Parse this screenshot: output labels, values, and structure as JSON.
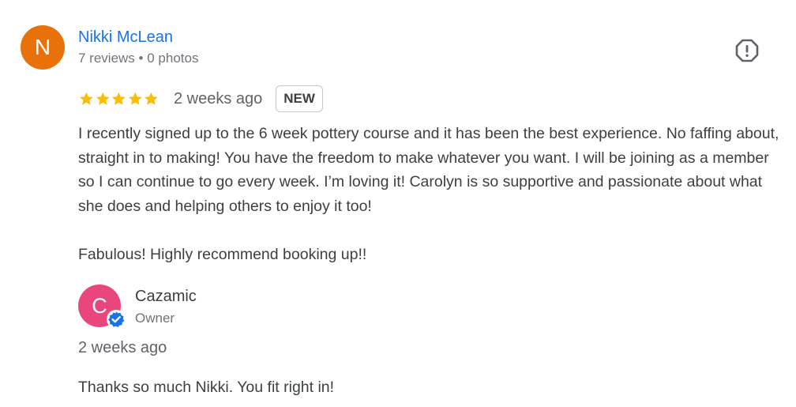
{
  "reviewer": {
    "initial": "N",
    "name": "Nikki McLean",
    "reviews_count": "7 reviews",
    "separator": "•",
    "photos_count": "0 photos",
    "avatar_color": "#e8710a"
  },
  "review": {
    "rating": 5,
    "rating_max": 5,
    "star_color": "#fbbc04",
    "time": "2 weeks ago",
    "badge": "NEW",
    "paragraphs": [
      "I recently signed up to the 6 week pottery course and it has been the best experience. No faffing about, straight in to making! You have the freedom to make whatever you want. I will be joining as a member so I can continue to go every week. I’m loving it! Carolyn is so supportive and passionate about what she does and helping others to enjoy it too!",
      "Fabulous! Highly recommend booking up!!"
    ]
  },
  "report": {
    "icon": "report-icon"
  },
  "owner_reply": {
    "initial": "C",
    "name": "Cazamic",
    "role": "Owner",
    "time": "2 weeks ago",
    "text": "Thanks so much Nikki. You fit right in!",
    "avatar_color": "#e8467c",
    "verified_color": "#1a73e8"
  }
}
